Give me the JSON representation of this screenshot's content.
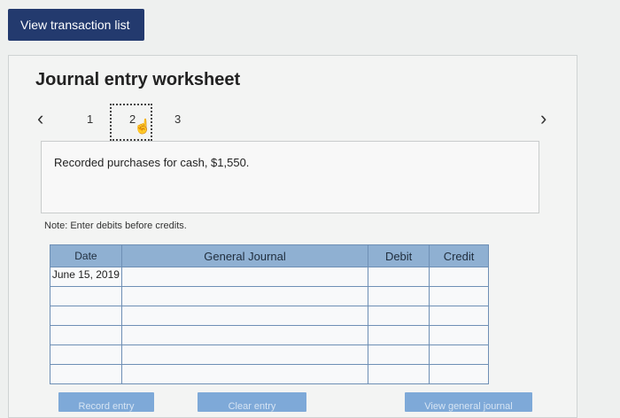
{
  "header": {
    "view_transaction_list_label": "View transaction list"
  },
  "worksheet": {
    "title": "Journal entry worksheet",
    "pages": [
      "1",
      "2",
      "3"
    ],
    "current_page": "2",
    "description": "Recorded purchases for cash, $1,550.",
    "note": "Note: Enter debits before credits."
  },
  "journal_table": {
    "headers": {
      "date": "Date",
      "general_journal": "General Journal",
      "debit": "Debit",
      "credit": "Credit"
    },
    "rows": [
      {
        "date": "June 15, 2019",
        "account": "",
        "debit": "",
        "credit": ""
      },
      {
        "date": "",
        "account": "",
        "debit": "",
        "credit": ""
      },
      {
        "date": "",
        "account": "",
        "debit": "",
        "credit": ""
      },
      {
        "date": "",
        "account": "",
        "debit": "",
        "credit": ""
      },
      {
        "date": "",
        "account": "",
        "debit": "",
        "credit": ""
      },
      {
        "date": "",
        "account": "",
        "debit": "",
        "credit": ""
      }
    ]
  },
  "buttons": {
    "record_entry": "Record entry",
    "clear_entry": "Clear entry",
    "view_general_journal": "View general journal"
  },
  "icons": {
    "prev": "chevron-left-icon",
    "next": "chevron-right-icon",
    "cursor": "hand-pointer-icon"
  }
}
